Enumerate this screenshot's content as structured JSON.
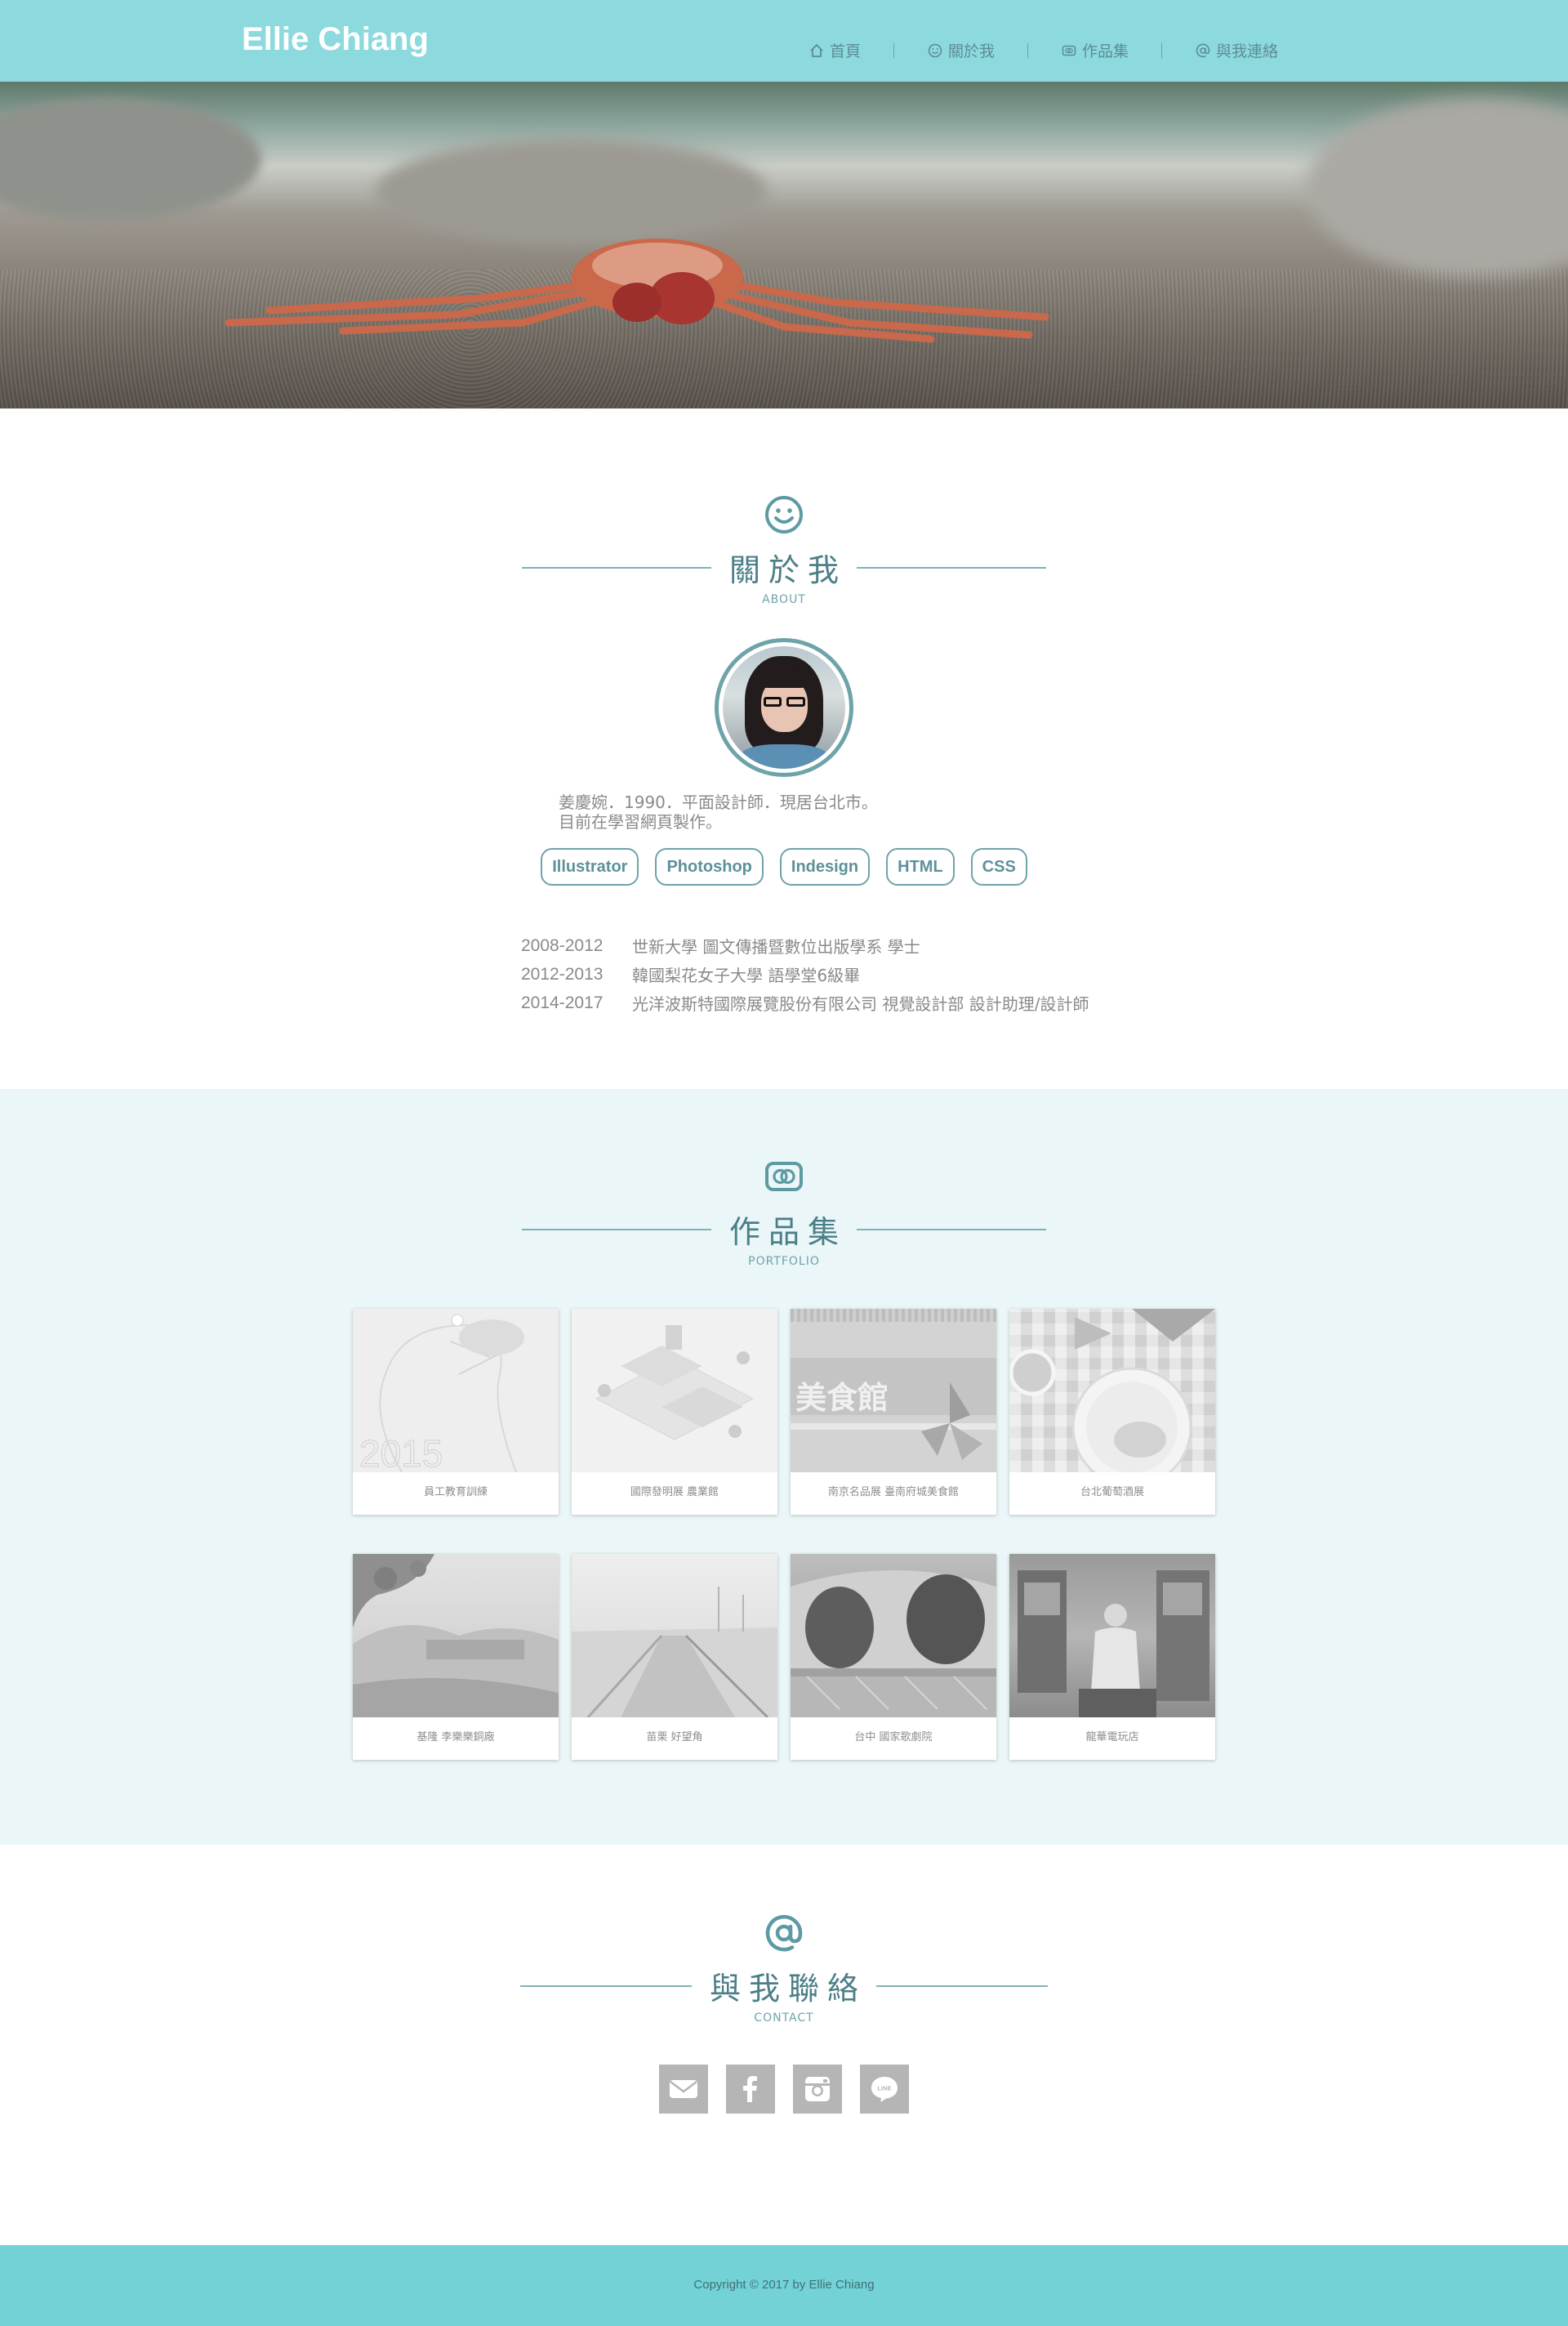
{
  "header": {
    "brand": "Ellie Chiang",
    "nav": [
      {
        "label": "首頁",
        "icon": "home-icon"
      },
      {
        "label": "關於我",
        "icon": "smile-icon"
      },
      {
        "label": "作品集",
        "icon": "portfolio-icon"
      },
      {
        "label": "與我連絡",
        "icon": "at-icon"
      }
    ]
  },
  "about": {
    "title": "關於我",
    "subtitle": "ABOUT",
    "intro_line1": "姜慶婉．1990．平面設計師．現居台北市。",
    "intro_line2": "目前在學習網頁製作。",
    "skills": [
      "Illustrator",
      "Photoshop",
      "Indesign",
      "HTML",
      "CSS"
    ],
    "timeline": [
      {
        "years": "2008-2012",
        "text": "世新大學 圖文傳播暨數位出版學系 學士"
      },
      {
        "years": "2012-2013",
        "text": "韓國梨花女子大學 語學堂6級畢"
      },
      {
        "years": "2014-2017",
        "text": "光洋波斯特國際展覽股份有限公司 視覺設計部 設計助理/設計師"
      }
    ]
  },
  "portfolio": {
    "title": "作品集",
    "subtitle": "PORTFOLIO",
    "items": [
      {
        "caption": "員工教育訓練",
        "thumb_text": "2015"
      },
      {
        "caption": "國際發明展 農業館"
      },
      {
        "caption": "南京名品展 臺南府城美食館",
        "thumb_text": "美食館"
      },
      {
        "caption": "台北葡萄酒展"
      },
      {
        "caption": "基隆 李樂樂銅廠"
      },
      {
        "caption": "苗栗 好望角"
      },
      {
        "caption": "台中 國家歌劇院"
      },
      {
        "caption": "龍華電玩店"
      }
    ]
  },
  "contact": {
    "title": "與我聯絡",
    "subtitle": "CONTACT",
    "social": [
      {
        "name": "email",
        "icon": "mail-icon"
      },
      {
        "name": "facebook",
        "icon": "facebook-icon"
      },
      {
        "name": "instagram",
        "icon": "instagram-icon"
      },
      {
        "name": "line",
        "icon": "line-icon",
        "icon_text": "LINE"
      }
    ]
  },
  "footer": {
    "copyright": "Copyright © 2017 by Ellie Chiang"
  },
  "colors": {
    "header_bg": "#8cd9de",
    "accent": "#6fa3aa",
    "portfolio_bg": "#eaf6f7",
    "footer_bg": "#72d2d6",
    "social_bg": "#b5b5b5"
  }
}
